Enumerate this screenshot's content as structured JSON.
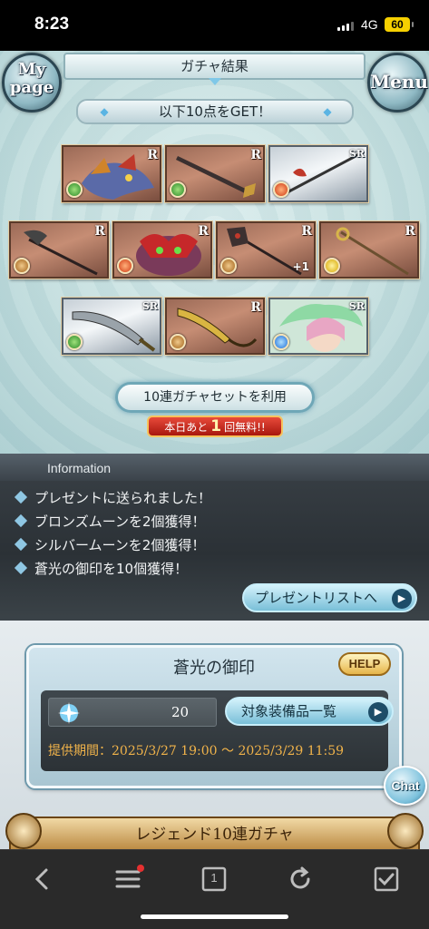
{
  "status_bar": {
    "time": "8:23",
    "network": "4G",
    "battery": "60"
  },
  "header": {
    "title": "ガチャ結果",
    "mypage_label": "My page",
    "menu_label": "Menu"
  },
  "result_banner": "以下10点をGET！",
  "cards": [
    {
      "rarity": "R",
      "element": "wind",
      "kind": "summon"
    },
    {
      "rarity": "R",
      "element": "wind",
      "kind": "sword"
    },
    {
      "rarity": "SR",
      "element": "fire",
      "kind": "spear"
    },
    {
      "rarity": "R",
      "element": "earth",
      "kind": "pickaxe"
    },
    {
      "rarity": "R",
      "element": "fire",
      "kind": "summon"
    },
    {
      "rarity": "R",
      "element": "earth",
      "kind": "axe",
      "plus": "+1"
    },
    {
      "rarity": "R",
      "element": "light",
      "kind": "staff"
    },
    {
      "rarity": "SR",
      "element": "wind",
      "kind": "blade"
    },
    {
      "rarity": "R",
      "element": "earth",
      "kind": "scimitar"
    },
    {
      "rarity": "SR",
      "element": "water",
      "kind": "character"
    }
  ],
  "set_button": "10連ガチャセットを利用",
  "free_badge": {
    "prefix": "本日あと",
    "count": "1",
    "suffix": "回無料!!"
  },
  "information": {
    "heading": "Information",
    "items": [
      "プレゼントに送られました！",
      "ブロンズムーンを2個獲得！",
      "シルバームーンを2個獲得！",
      "蒼光の御印を10個獲得！"
    ],
    "present_button": "プレゼントリストへ"
  },
  "panel": {
    "title": "蒼光の御印",
    "help_label": "HELP",
    "count": "20",
    "equip_button": "対象装備品一覧",
    "period": "提供期間：2025/3/27 19:00 〜 2025/3/29 11:59"
  },
  "chat_label": "Chat",
  "legend_banner": "レジェンド10連ガチャ",
  "toolbar": {
    "tabs_count": "1"
  },
  "colors": {
    "info_bg": "#2b3136",
    "accent_blue": "#79bfd8",
    "period_text": "#f0b34a",
    "free_red": "#a8170e"
  }
}
